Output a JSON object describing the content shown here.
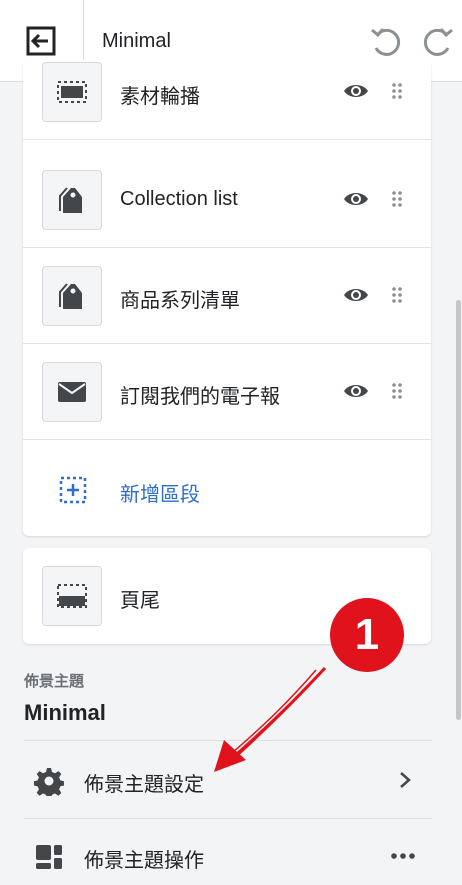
{
  "header": {
    "theme_name": "Minimal",
    "exit_icon": "exit-icon",
    "undo_icon": "undo-icon",
    "redo_icon": "redo-icon"
  },
  "sections": [
    {
      "label": "素材輪播",
      "icon": "slideshow-icon"
    },
    {
      "label": "Collection list",
      "icon": "tag-icon"
    },
    {
      "label": "商品系列清單",
      "icon": "tag-icon"
    },
    {
      "label": "訂閱我們的電子報",
      "icon": "mail-icon"
    }
  ],
  "add_section": {
    "label": "新增區段",
    "color": "#2c6ecb"
  },
  "footer_section": {
    "label": "頁尾",
    "icon": "footer-icon"
  },
  "theme_info": {
    "caption": "佈景主題",
    "name": "Minimal"
  },
  "menu": [
    {
      "label": "佈景主題設定",
      "icon": "gear-icon"
    },
    {
      "label": "佈景主題操作",
      "icon": "layout-icon"
    }
  ],
  "annotation": {
    "number": "1",
    "color": "#e0121b"
  }
}
